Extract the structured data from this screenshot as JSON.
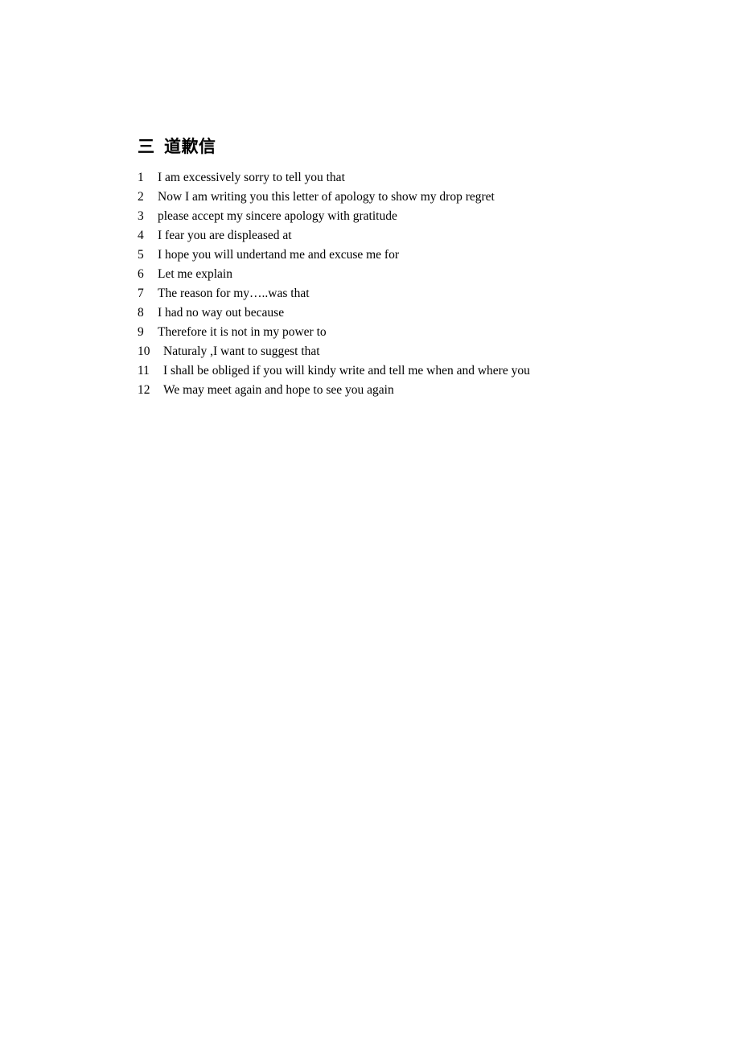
{
  "document": {
    "heading": "三  道歉信",
    "phrases": [
      {
        "number": "1",
        "text": "I am excessively sorry to tell you that"
      },
      {
        "number": "2",
        "text": "Now I am writing you this letter of apology to show my drop regret"
      },
      {
        "number": "3",
        "text": "please accept my sincere apology with gratitude"
      },
      {
        "number": "4",
        "text": "I fear you are displeased at"
      },
      {
        "number": "5",
        "text": "I hope you will undertand me and excuse me for"
      },
      {
        "number": "6",
        "text": "Let me explain"
      },
      {
        "number": "7",
        "text": "The reason for my…..was that"
      },
      {
        "number": "8",
        "text": "I had no way out because"
      },
      {
        "number": "9",
        "text": "Therefore it is not in my power to"
      },
      {
        "number": "10",
        "text": "Naturaly ,I want to suggest that"
      },
      {
        "number": "11",
        "text": "I shall be obliged if you will kindy write and tell me when and where you"
      },
      {
        "number": "12",
        "text": "We may meet again and hope to see you again"
      }
    ]
  }
}
